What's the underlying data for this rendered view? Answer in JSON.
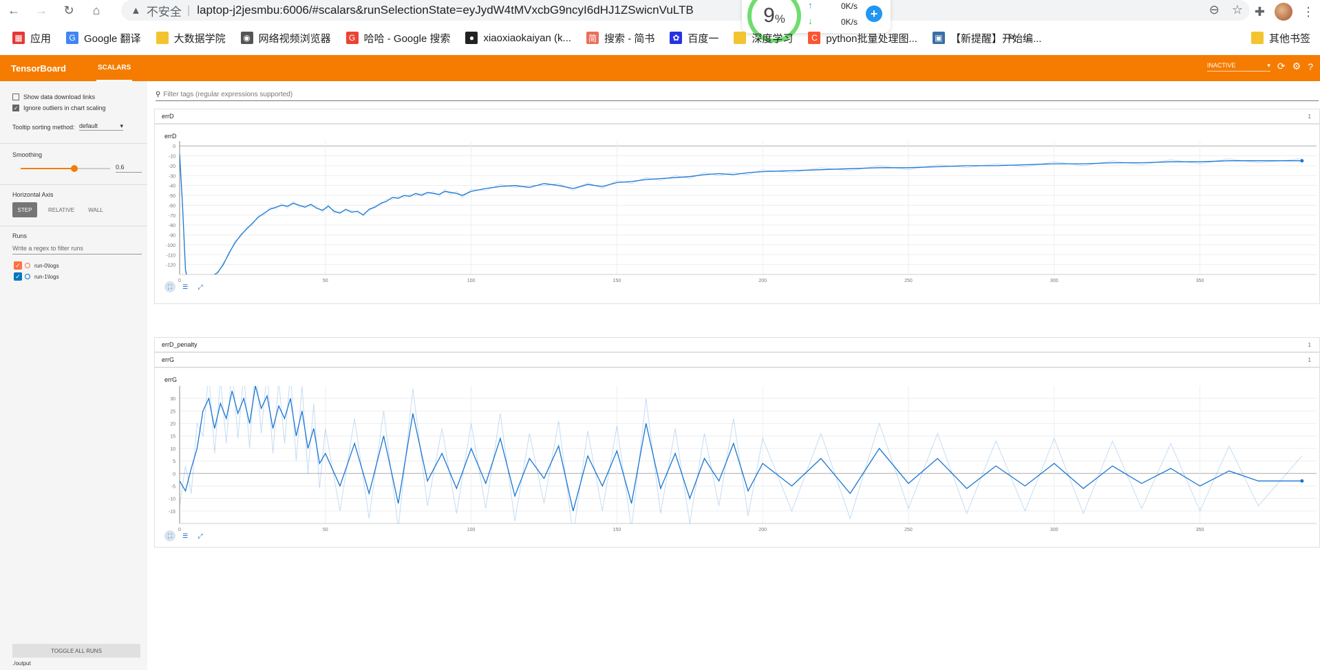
{
  "browser": {
    "insecure_label": "不安全",
    "url": "laptop-j2jesmbu:6006/#scalars&runSelectionState=eyJydW4tMVxcbG9ncyI6dHJ1ZSwicnVuLTB",
    "net_percent": "9",
    "net_percent_unit": "%",
    "net_up": "0K/s",
    "net_down": "0K/s",
    "bookmarks": [
      {
        "label": "应用",
        "icon": "apps-grid-icon",
        "color": "#e53935"
      },
      {
        "label": "Google 翻译",
        "icon": "google-translate-icon",
        "color": "#4285f4"
      },
      {
        "label": "大数据学院",
        "icon": "folder-icon",
        "color": "#f4c430"
      },
      {
        "label": "网络视频浏览器",
        "icon": "globe-icon",
        "color": "#555555"
      },
      {
        "label": "哈哈 - Google 搜索",
        "icon": "google-icon",
        "color": "#ea4335"
      },
      {
        "label": "xiaoxiaokaiyan (k...",
        "icon": "github-icon",
        "color": "#222222"
      },
      {
        "label": "搜索 - 简书",
        "icon": "jianshu-icon",
        "color": "#ea6f5a"
      },
      {
        "label": "百度一",
        "icon": "baidu-icon",
        "color": "#2932e1"
      },
      {
        "label": "深度学习",
        "icon": "folder-icon",
        "color": "#f4c430"
      },
      {
        "label": "python批量处理图...",
        "icon": "csdn-icon",
        "color": "#fc5531"
      },
      {
        "label": "【新提醒】开始编...",
        "icon": "forum-icon",
        "color": "#3a6ea5"
      }
    ],
    "more": "»",
    "other_bookmarks": "其他书签"
  },
  "tensorboard": {
    "title": "TensorBoard",
    "tab": "SCALARS",
    "status": "INACTIVE"
  },
  "sidebar": {
    "show_download": "Show data download links",
    "ignore_outliers": "Ignore outliers in chart scaling",
    "tooltip_label": "Tooltip sorting method:",
    "tooltip_value": "default",
    "smoothing_label": "Smoothing",
    "smoothing_value": "0.6",
    "smoothing_fraction": 0.6,
    "haxis_label": "Horizontal Axis",
    "axis_step": "STEP",
    "axis_relative": "RELATIVE",
    "axis_wall": "WALL",
    "runs_label": "Runs",
    "runs_filter_placeholder": "Write a regex to filter runs",
    "runs": [
      {
        "name": "run-0\\logs",
        "color": "#ff7043"
      },
      {
        "name": "run-1\\logs",
        "color": "#0277bd"
      }
    ],
    "toggle_all": "TOGGLE ALL RUNS",
    "output_path": "./output"
  },
  "main": {
    "filter_placeholder": "Filter tags (regular expressions supported)",
    "sections": [
      {
        "name": "errD",
        "count": "1"
      },
      {
        "name": "errD_penalty",
        "count": "1"
      },
      {
        "name": "errG",
        "count": "1"
      }
    ]
  },
  "chart_data": [
    {
      "type": "line",
      "title": "errD",
      "xlabel": "",
      "ylabel": "",
      "xlim": [
        0,
        390
      ],
      "ylim": [
        -130,
        5
      ],
      "x_ticks": [
        "0",
        "50",
        "100",
        "150",
        "200",
        "250",
        "300",
        "350"
      ],
      "x_tick_values": [
        0,
        50,
        100,
        150,
        200,
        250,
        300,
        350
      ],
      "y_ticks": [
        "0",
        "-10",
        "-20",
        "-30",
        "-40",
        "-50",
        "-60",
        "-70",
        "-80",
        "-90",
        "-100",
        "-110",
        "-120"
      ],
      "y_tick_values": [
        0,
        -10,
        -20,
        -30,
        -40,
        -50,
        -60,
        -70,
        -80,
        -90,
        -100,
        -110,
        -120
      ],
      "series": [
        {
          "color": "#1976d2",
          "x": [
            0,
            1,
            2,
            3,
            5,
            7,
            9,
            11,
            13,
            15,
            17,
            19,
            21,
            23,
            25,
            27,
            29,
            31,
            33,
            35,
            37,
            39,
            41,
            43,
            45,
            47,
            49,
            51,
            53,
            55,
            57,
            59,
            61,
            63,
            65,
            67,
            69,
            71,
            73,
            75,
            77,
            79,
            81,
            83,
            85,
            87,
            89,
            91,
            93,
            95,
            97,
            100,
            105,
            110,
            115,
            120,
            125,
            130,
            135,
            140,
            145,
            150,
            155,
            160,
            165,
            170,
            175,
            180,
            185,
            190,
            195,
            200,
            210,
            220,
            230,
            240,
            250,
            260,
            270,
            280,
            290,
            300,
            310,
            320,
            330,
            340,
            350,
            360,
            370,
            385
          ],
          "y": [
            -8,
            -60,
            -125,
            -140,
            -145,
            -140,
            -135,
            -132,
            -128,
            -120,
            -108,
            -98,
            -90,
            -84,
            -78,
            -72,
            -68,
            -64,
            -62,
            -60,
            -61,
            -58,
            -60,
            -62,
            -59,
            -63,
            -65,
            -61,
            -66,
            -68,
            -64,
            -67,
            -66,
            -70,
            -64,
            -62,
            -58,
            -56,
            -52,
            -53,
            -50,
            -51,
            -48,
            -50,
            -47,
            -48,
            -49,
            -46,
            -47,
            -48,
            -50,
            -46,
            -43,
            -41,
            -40,
            -42,
            -38,
            -40,
            -43,
            -39,
            -41,
            -37,
            -36,
            -34,
            -33,
            -32,
            -31,
            -29,
            -28,
            -29,
            -27,
            -26,
            -25,
            -24,
            -23,
            -22,
            -22,
            -21,
            -20,
            -20,
            -19,
            -18,
            -18,
            -17,
            -17,
            -16,
            -16,
            -15,
            -15,
            -15
          ]
        }
      ]
    },
    {
      "type": "line",
      "title": "errG",
      "xlabel": "",
      "ylabel": "",
      "xlim": [
        0,
        390
      ],
      "ylim": [
        -20,
        35
      ],
      "x_ticks": [
        "0",
        "50",
        "100",
        "150",
        "200",
        "250",
        "300",
        "350"
      ],
      "x_tick_values": [
        0,
        50,
        100,
        150,
        200,
        250,
        300,
        350
      ],
      "y_ticks": [
        "30",
        "25",
        "20",
        "15",
        "10",
        "5",
        "0",
        "-5",
        "-10",
        "-15"
      ],
      "y_tick_values": [
        30,
        25,
        20,
        15,
        10,
        5,
        0,
        -5,
        -10,
        -15
      ],
      "series": [
        {
          "color": "#1976d2",
          "x": [
            0,
            2,
            4,
            6,
            8,
            10,
            12,
            14,
            16,
            18,
            20,
            22,
            24,
            26,
            28,
            30,
            32,
            34,
            36,
            38,
            40,
            42,
            44,
            46,
            48,
            50,
            55,
            60,
            65,
            70,
            75,
            80,
            85,
            90,
            95,
            100,
            105,
            110,
            115,
            120,
            125,
            130,
            135,
            140,
            145,
            150,
            155,
            160,
            165,
            170,
            175,
            180,
            185,
            190,
            195,
            200,
            210,
            220,
            230,
            240,
            250,
            260,
            270,
            280,
            290,
            300,
            310,
            320,
            330,
            340,
            350,
            360,
            370,
            385
          ],
          "y": [
            -3,
            -7,
            2,
            10,
            25,
            30,
            18,
            28,
            22,
            33,
            24,
            30,
            20,
            35,
            26,
            31,
            18,
            27,
            22,
            30,
            15,
            25,
            10,
            18,
            4,
            8,
            -5,
            12,
            -8,
            15,
            -12,
            24,
            -3,
            8,
            -6,
            10,
            -4,
            14,
            -9,
            6,
            -2,
            11,
            -15,
            7,
            -5,
            9,
            -12,
            20,
            -6,
            8,
            -10,
            6,
            -3,
            12,
            -7,
            4,
            -5,
            6,
            -8,
            10,
            -4,
            6,
            -6,
            3,
            -5,
            4,
            -6,
            3,
            -4,
            2,
            -5,
            1,
            -3,
            -3
          ]
        }
      ]
    }
  ]
}
